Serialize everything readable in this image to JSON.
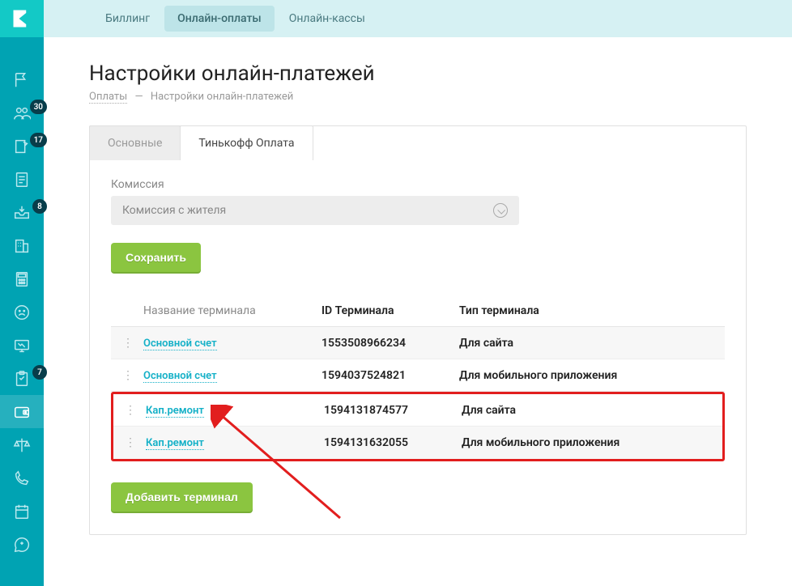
{
  "topbar": {
    "tabs": [
      {
        "label": "Биллинг",
        "selected": false
      },
      {
        "label": "Онлайн-оплаты",
        "selected": true
      },
      {
        "label": "Онлайн-кассы",
        "selected": false
      }
    ]
  },
  "page": {
    "title": "Настройки онлайн-платежей",
    "breadcrumb": {
      "root": "Оплаты",
      "sep": "—",
      "current": "Настройки онлайн-платежей"
    }
  },
  "subtabs": [
    {
      "label": "Основные",
      "selected": false
    },
    {
      "label": "Тинькофф Оплата",
      "selected": true
    }
  ],
  "commission": {
    "label": "Комиссия",
    "value": "Комиссия с жителя"
  },
  "buttons": {
    "save": "Сохранить",
    "add": "Добавить терминал"
  },
  "table": {
    "columns": {
      "name": "Название терминала",
      "id": "ID Терминала",
      "type": "Тип терминала"
    },
    "rows": [
      {
        "name": "Основной счет",
        "id": "1553508966234",
        "type": "Для сайта",
        "hl": false
      },
      {
        "name": "Основной счет",
        "id": "1594037524821",
        "type": "Для мобильного приложения",
        "hl": false
      },
      {
        "name": "Кап.ремонт",
        "id": "1594131874577",
        "type": "Для сайта",
        "hl": true
      },
      {
        "name": "Кап.ремонт",
        "id": "1594131632055",
        "type": "Для мобильного приложения",
        "hl": true
      }
    ]
  },
  "sidebar": {
    "badges": {
      "nav2": "30",
      "nav3": "17",
      "nav5": "8",
      "nav10": "7"
    }
  }
}
